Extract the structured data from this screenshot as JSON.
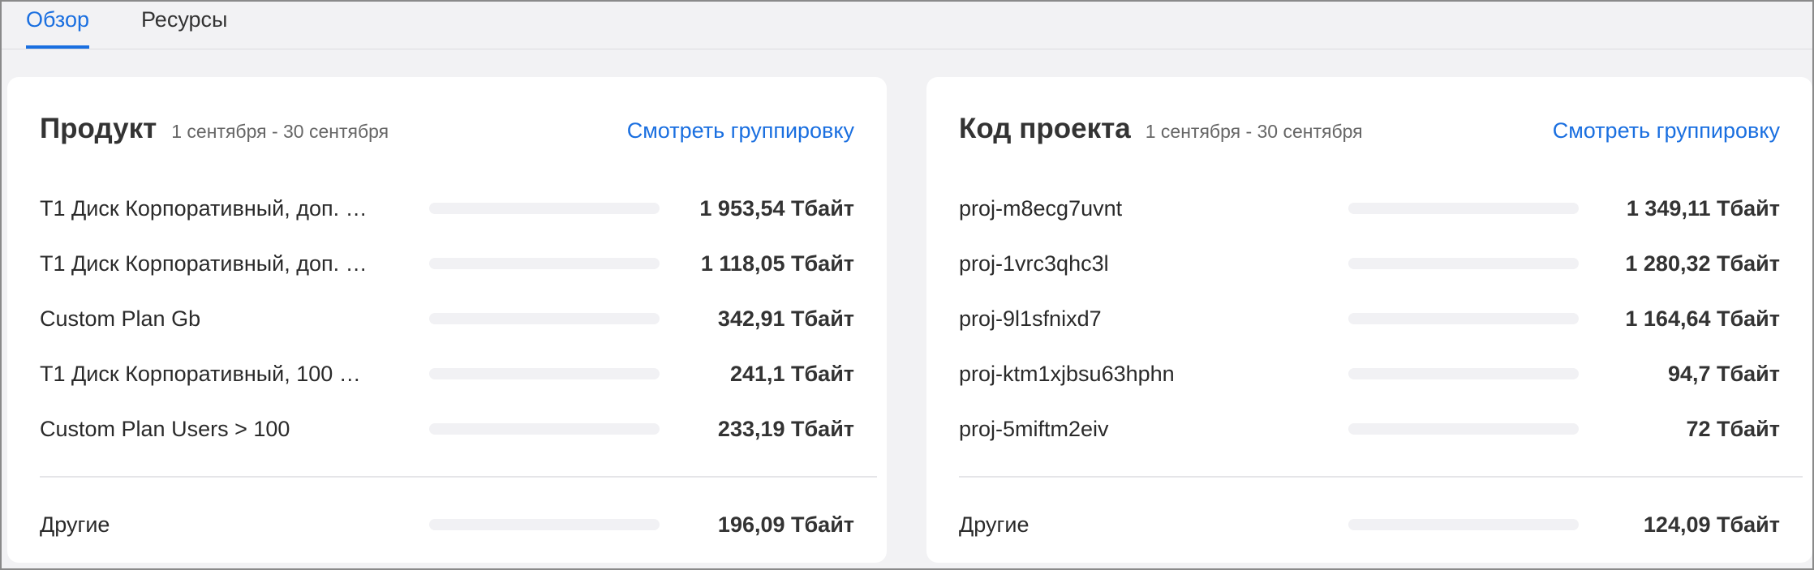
{
  "tabs": [
    {
      "label": "Обзор",
      "active": true
    },
    {
      "label": "Ресурсы",
      "active": false
    }
  ],
  "accent_color": "#1a6fe0",
  "product_card": {
    "title": "Продукт",
    "period": "1 сентября - 30 сентября",
    "link": "Смотреть группировку",
    "rows": [
      {
        "label": "T1 Диск Корпоративный, доп. …",
        "value": "1 953,54 Тбайт"
      },
      {
        "label": "T1 Диск Корпоративный, доп. …",
        "value": "1 118,05 Тбайт"
      },
      {
        "label": "Custom Plan Gb",
        "value": "342,91 Тбайт"
      },
      {
        "label": "T1 Диск Корпоративный, 100 …",
        "value": "241,1 Тбайт"
      },
      {
        "label": "Custom Plan Users > 100",
        "value": "233,19 Тбайт"
      }
    ],
    "other": {
      "label": "Другие",
      "value": "196,09 Тбайт"
    }
  },
  "project_card": {
    "title": "Код проекта",
    "period": "1 сентября - 30 сентября",
    "link": "Смотреть группировку",
    "rows": [
      {
        "label": "proj-m8ecg7uvnt",
        "value": "1 349,11 Тбайт"
      },
      {
        "label": "proj-1vrc3qhc3l",
        "value": "1 280,32 Тбайт"
      },
      {
        "label": "proj-9l1sfnixd7",
        "value": "1 164,64 Тбайт"
      },
      {
        "label": "proj-ktm1xjbsu63hphn",
        "value": "94,7 Тбайт"
      },
      {
        "label": "proj-5miftm2eiv",
        "value": "72 Тбайт"
      }
    ],
    "other": {
      "label": "Другие",
      "value": "124,09 Тбайт"
    }
  }
}
